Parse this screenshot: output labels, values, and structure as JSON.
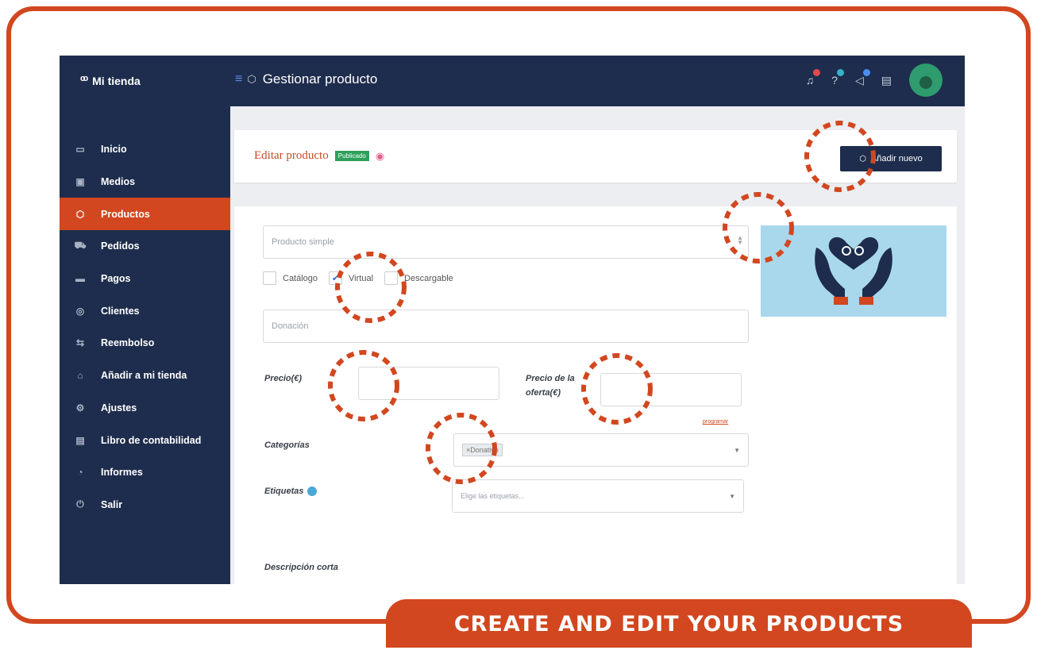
{
  "app": {
    "name": "Mi tienda"
  },
  "topbar": {
    "title": "Gestionar producto"
  },
  "sidebar": {
    "items": [
      {
        "label": "Inicio",
        "icon": "monitor-icon",
        "active": false
      },
      {
        "label": "Medios",
        "icon": "image-icon",
        "active": false
      },
      {
        "label": "Productos",
        "icon": "box-icon",
        "active": true
      },
      {
        "label": "Pedidos",
        "icon": "cart-icon",
        "active": false
      },
      {
        "label": "Pagos",
        "icon": "card-icon",
        "active": false
      },
      {
        "label": "Clientes",
        "icon": "user-icon",
        "active": false
      },
      {
        "label": "Reembolso",
        "icon": "refund-icon",
        "active": false
      },
      {
        "label": "Añadir a mi tienda",
        "icon": "store-icon",
        "active": false
      },
      {
        "label": "Ajustes",
        "icon": "settings-icon",
        "active": false
      },
      {
        "label": "Libro de contabilidad",
        "icon": "ledger-icon",
        "active": false
      },
      {
        "label": "Informes",
        "icon": "reports-icon",
        "active": false
      },
      {
        "label": "Salir",
        "icon": "power-icon",
        "active": false
      }
    ]
  },
  "editor": {
    "title": "Editar producto",
    "status_badge": "Publicado",
    "add_new_label": "Añadir nuevo",
    "product_type_placeholder": "Producto simple",
    "checkboxes": [
      {
        "label": "Catálogo",
        "checked": false
      },
      {
        "label": "Virtual",
        "checked": true
      },
      {
        "label": "Descargable",
        "checked": false
      }
    ],
    "name_placeholder": "Donación",
    "price_label": "Precio(€)",
    "offer_price_label_1": "Precio de la",
    "offer_price_label_2": "oferta(€)",
    "schedule_link": "programar",
    "categories_label": "Categorías",
    "category_chip": "×Donativo",
    "tags_label": "Etiquetas",
    "tags_placeholder": "Elige las etiquetas...",
    "short_description_label": "Descripción corta"
  },
  "banner": {
    "text": "CREATE AND EDIT YOUR PRODUCTS"
  },
  "colors": {
    "accent": "#d2471f",
    "navy": "#1e2d4d",
    "published": "#2ea05a",
    "preview_bg": "#a9d8ec"
  }
}
